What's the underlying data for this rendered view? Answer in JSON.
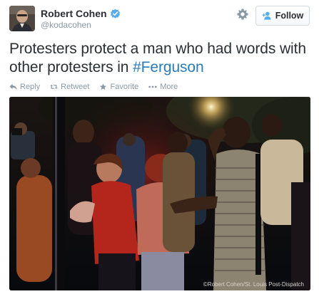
{
  "user": {
    "display_name": "Robert Cohen",
    "handle": "@kodacohen",
    "verified": true,
    "avatar_icon": "user-avatar"
  },
  "follow_button": {
    "label": "Follow",
    "icon": "add-user-icon"
  },
  "settings_icon": "gear-icon",
  "tweet": {
    "text_before": "Protesters protect a man who had words with other protesters in ",
    "hashtag": "#Ferguson"
  },
  "actions": [
    {
      "label": "Reply",
      "icon": "reply-icon"
    },
    {
      "label": "Retweet",
      "icon": "retweet-icon"
    },
    {
      "label": "Favorite",
      "icon": "star-icon"
    },
    {
      "label": "More",
      "icon": "more-icon"
    }
  ],
  "photo": {
    "credit": "©Robert Cohen/St. Louis Post-Dispatch"
  },
  "colors": {
    "link": "#2b7bb9",
    "verified": "#55acee",
    "muted": "#8899a6",
    "text": "#292f33"
  }
}
